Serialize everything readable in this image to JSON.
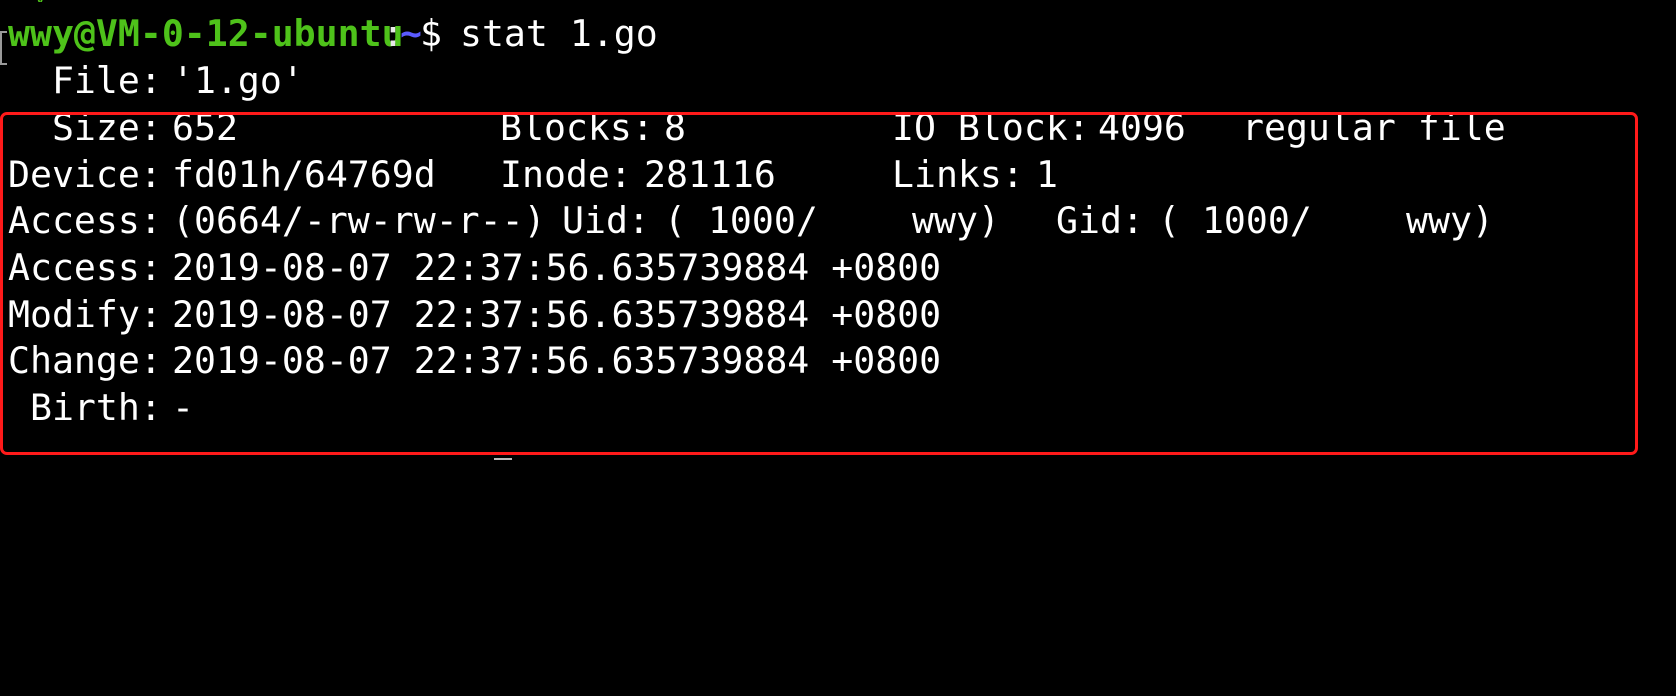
{
  "prompt": {
    "user_host": "wwy@VM-0-12-ubuntu",
    "colon": ":",
    "path": "~",
    "dollar": "$",
    "command": " stat 1.go"
  },
  "stat_output": {
    "file": {
      "label": "  File:",
      "value": "'1.go'"
    },
    "size": {
      "label": "  Size:",
      "value": "652"
    },
    "blocks": {
      "label": "Blocks:",
      "value": "8"
    },
    "io_block": {
      "label": "IO Block:",
      "value": "4096"
    },
    "file_type": "regular file",
    "device": {
      "label": "Device:",
      "value": "fd01h/64769d"
    },
    "inode": {
      "label": "Inode:",
      "value": "281116"
    },
    "links": {
      "label": "Links:",
      "value": "1"
    },
    "access_mode": {
      "label": "Access:",
      "value": "(0664/-rw-rw-r--)"
    },
    "uid": {
      "label": "Uid:",
      "value": "( 1000/",
      "name": "wwy)"
    },
    "gid": {
      "label": "Gid:",
      "value": "( 1000/",
      "name": "wwy)"
    },
    "access_time": {
      "label": "Access:",
      "value": "2019-08-07 22:37:56.635739884 +0800"
    },
    "modify_time": {
      "label": "Modify:",
      "value": "2019-08-07 22:37:56.635739884 +0800"
    },
    "change_time": {
      "label": "Change:",
      "value": "2019-08-07 22:37:56.635739884 +0800"
    },
    "birth": {
      "label": " Birth:",
      "value": "-"
    }
  },
  "colors": {
    "background": "#000000",
    "prompt_user": "#4ec21a",
    "prompt_path": "#5b5bff",
    "text": "#ffffff",
    "highlight_border": "#ff1a1a"
  }
}
